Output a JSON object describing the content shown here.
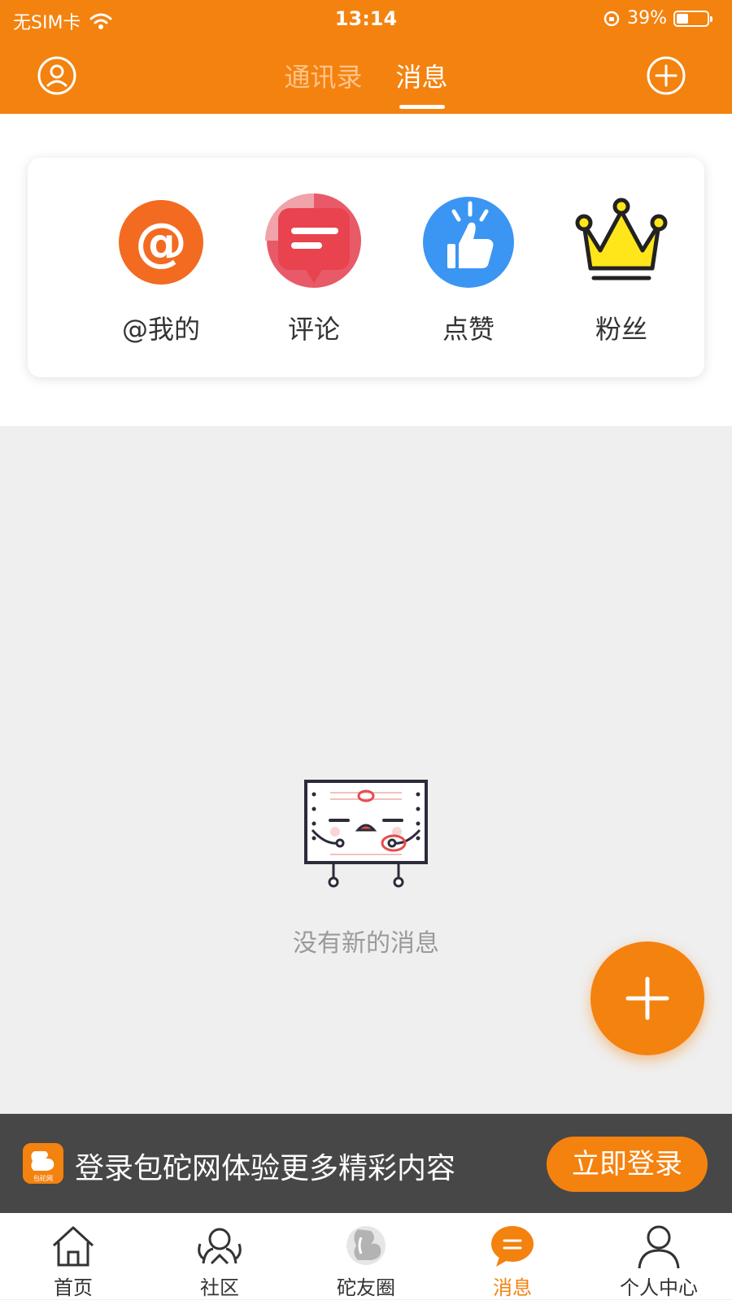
{
  "status_bar": {
    "carrier": "无SIM卡",
    "time": "13:14",
    "battery": "39%"
  },
  "header": {
    "tabs": [
      {
        "label": "通讯录",
        "active": false
      },
      {
        "label": "消息",
        "active": true
      }
    ],
    "left_icon": "user-icon",
    "right_icon": "plus-circle-icon"
  },
  "shortcuts": [
    {
      "label": "@我的",
      "icon": "at-icon"
    },
    {
      "label": "评论",
      "icon": "comment-icon"
    },
    {
      "label": "点赞",
      "icon": "thumbs-up-icon"
    },
    {
      "label": "粉丝",
      "icon": "crown-icon"
    }
  ],
  "empty_state": {
    "message": "没有新的消息"
  },
  "fab": {
    "icon": "plus-icon"
  },
  "login_banner": {
    "logo_text": "包砣网",
    "text": "登录包砣网体验更多精彩内容",
    "button": "立即登录"
  },
  "bottom_nav": [
    {
      "label": "首页",
      "icon": "home-icon",
      "active": false
    },
    {
      "label": "社区",
      "icon": "community-icon",
      "active": false
    },
    {
      "label": "砣友圈",
      "icon": "circle-logo-icon",
      "active": false
    },
    {
      "label": "消息",
      "icon": "message-icon",
      "active": true
    },
    {
      "label": "个人中心",
      "icon": "profile-icon",
      "active": false
    }
  ],
  "colors": {
    "brand": "#f4820f",
    "background": "#efefef"
  }
}
